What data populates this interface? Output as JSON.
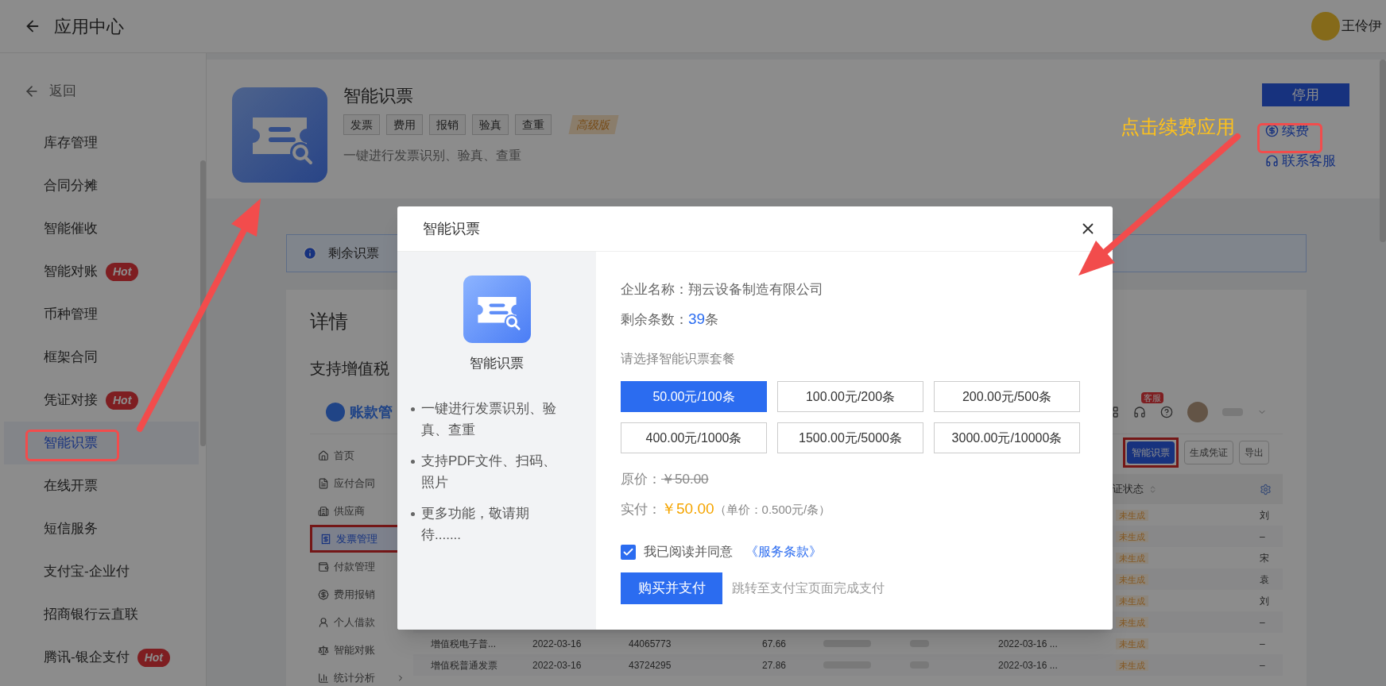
{
  "header": {
    "title": "应用中心",
    "user": {
      "name": "王伶伊"
    }
  },
  "sidebar": {
    "back": "返回",
    "items": [
      {
        "label": "库存管理",
        "selected": false
      },
      {
        "label": "合同分摊",
        "selected": false
      },
      {
        "label": "智能催收",
        "selected": false
      },
      {
        "label": "智能对账",
        "badge": "Hot",
        "selected": false
      },
      {
        "label": "币种管理",
        "selected": false
      },
      {
        "label": "框架合同",
        "selected": false
      },
      {
        "label": "凭证对接",
        "badge": "Hot",
        "selected": false
      },
      {
        "label": "智能识票",
        "selected": true
      },
      {
        "label": "在线开票",
        "selected": false
      },
      {
        "label": "短信服务",
        "selected": false
      },
      {
        "label": "支付宝-企业付",
        "selected": false
      },
      {
        "label": "招商银行云直联",
        "selected": false
      },
      {
        "label": "腾讯-银企支付",
        "badge": "Hot",
        "selected": false
      }
    ]
  },
  "app": {
    "name": "智能识票",
    "tags": [
      "发票",
      "费用",
      "报销",
      "验真",
      "查重"
    ],
    "edition": "高级版",
    "description": "一键进行发票识别、验真、查重",
    "disable": "停用",
    "renew": "续费",
    "support": "联系客服"
  },
  "notice": "剩余识票",
  "details": {
    "title": "详情",
    "intro": "支持增值税",
    "screenshot": {
      "logo": "账款管",
      "support_badge": "客服",
      "nav": [
        {
          "label": "首页",
          "selected": false
        },
        {
          "label": "应付合同",
          "selected": false
        },
        {
          "label": "供应商",
          "selected": false
        },
        {
          "label": "发票管理",
          "selected": true
        },
        {
          "label": "付款管理",
          "selected": false
        },
        {
          "label": "费用报销",
          "selected": false
        },
        {
          "label": "个人借款",
          "selected": false
        },
        {
          "label": "智能对账",
          "selected": false
        },
        {
          "label": "统计分析",
          "selected": false
        }
      ],
      "toolbar": [
        {
          "label": "智能识票",
          "kind": "primary"
        },
        {
          "label": "生成凭证",
          "kind": "default"
        },
        {
          "label": "导出",
          "kind": "default"
        }
      ],
      "status_column": "证状态",
      "rows": [
        {
          "status": "未生成",
          "last": "刘"
        },
        {
          "status": "未生成",
          "last": "–"
        },
        {
          "status": "未生成",
          "last": "宋"
        },
        {
          "status": "未生成",
          "last": "袁"
        },
        {
          "status": "未生成",
          "last": "刘"
        },
        {
          "status": "未生成",
          "last": "–"
        },
        {
          "type": "增值税电子普...",
          "date": "2022-03-16",
          "number": "44065773",
          "amount": "67.66",
          "time": "2022-03-16 ...",
          "status": "未生成",
          "last": "–"
        },
        {
          "type": "增值税普通发票",
          "date": "2022-03-16",
          "number": "43724295",
          "amount": "27.86",
          "time": "2022-03-16 ...",
          "status": "未生成",
          "last": "–"
        }
      ]
    }
  },
  "modal": {
    "title": "智能识票",
    "product": "智能识票",
    "features": [
      "一键进行发票识别、验真、查重",
      "支持PDF文件、扫码、照片",
      "更多功能，敬请期待......."
    ],
    "company_label": "企业名称：",
    "company": "翔云设备制造有限公司",
    "remaining_label": "剩余条数：",
    "remaining": "39",
    "remaining_unit": "条",
    "plan_prompt": "请选择智能识票套餐",
    "plans": [
      {
        "label": "50.00元/100条",
        "selected": true
      },
      {
        "label": "100.00元/200条",
        "selected": false
      },
      {
        "label": "200.00元/500条",
        "selected": false
      },
      {
        "label": "400.00元/1000条",
        "selected": false
      },
      {
        "label": "1500.00元/5000条",
        "selected": false
      },
      {
        "label": "3000.00元/10000条",
        "selected": false
      }
    ],
    "original_label": "原价：",
    "original_price": "￥50.00",
    "pay_label": "实付：",
    "pay_price": "￥50.00",
    "unit_price": "（单价：0.500元/条）",
    "agree": {
      "checked": true,
      "text": "我已阅读并同意",
      "link": "《服务条款》"
    },
    "buy": "购买并支付",
    "buy_hint": "跳转至支付宝页面完成支付"
  },
  "annotations": {
    "callout": "点击续费应用"
  }
}
